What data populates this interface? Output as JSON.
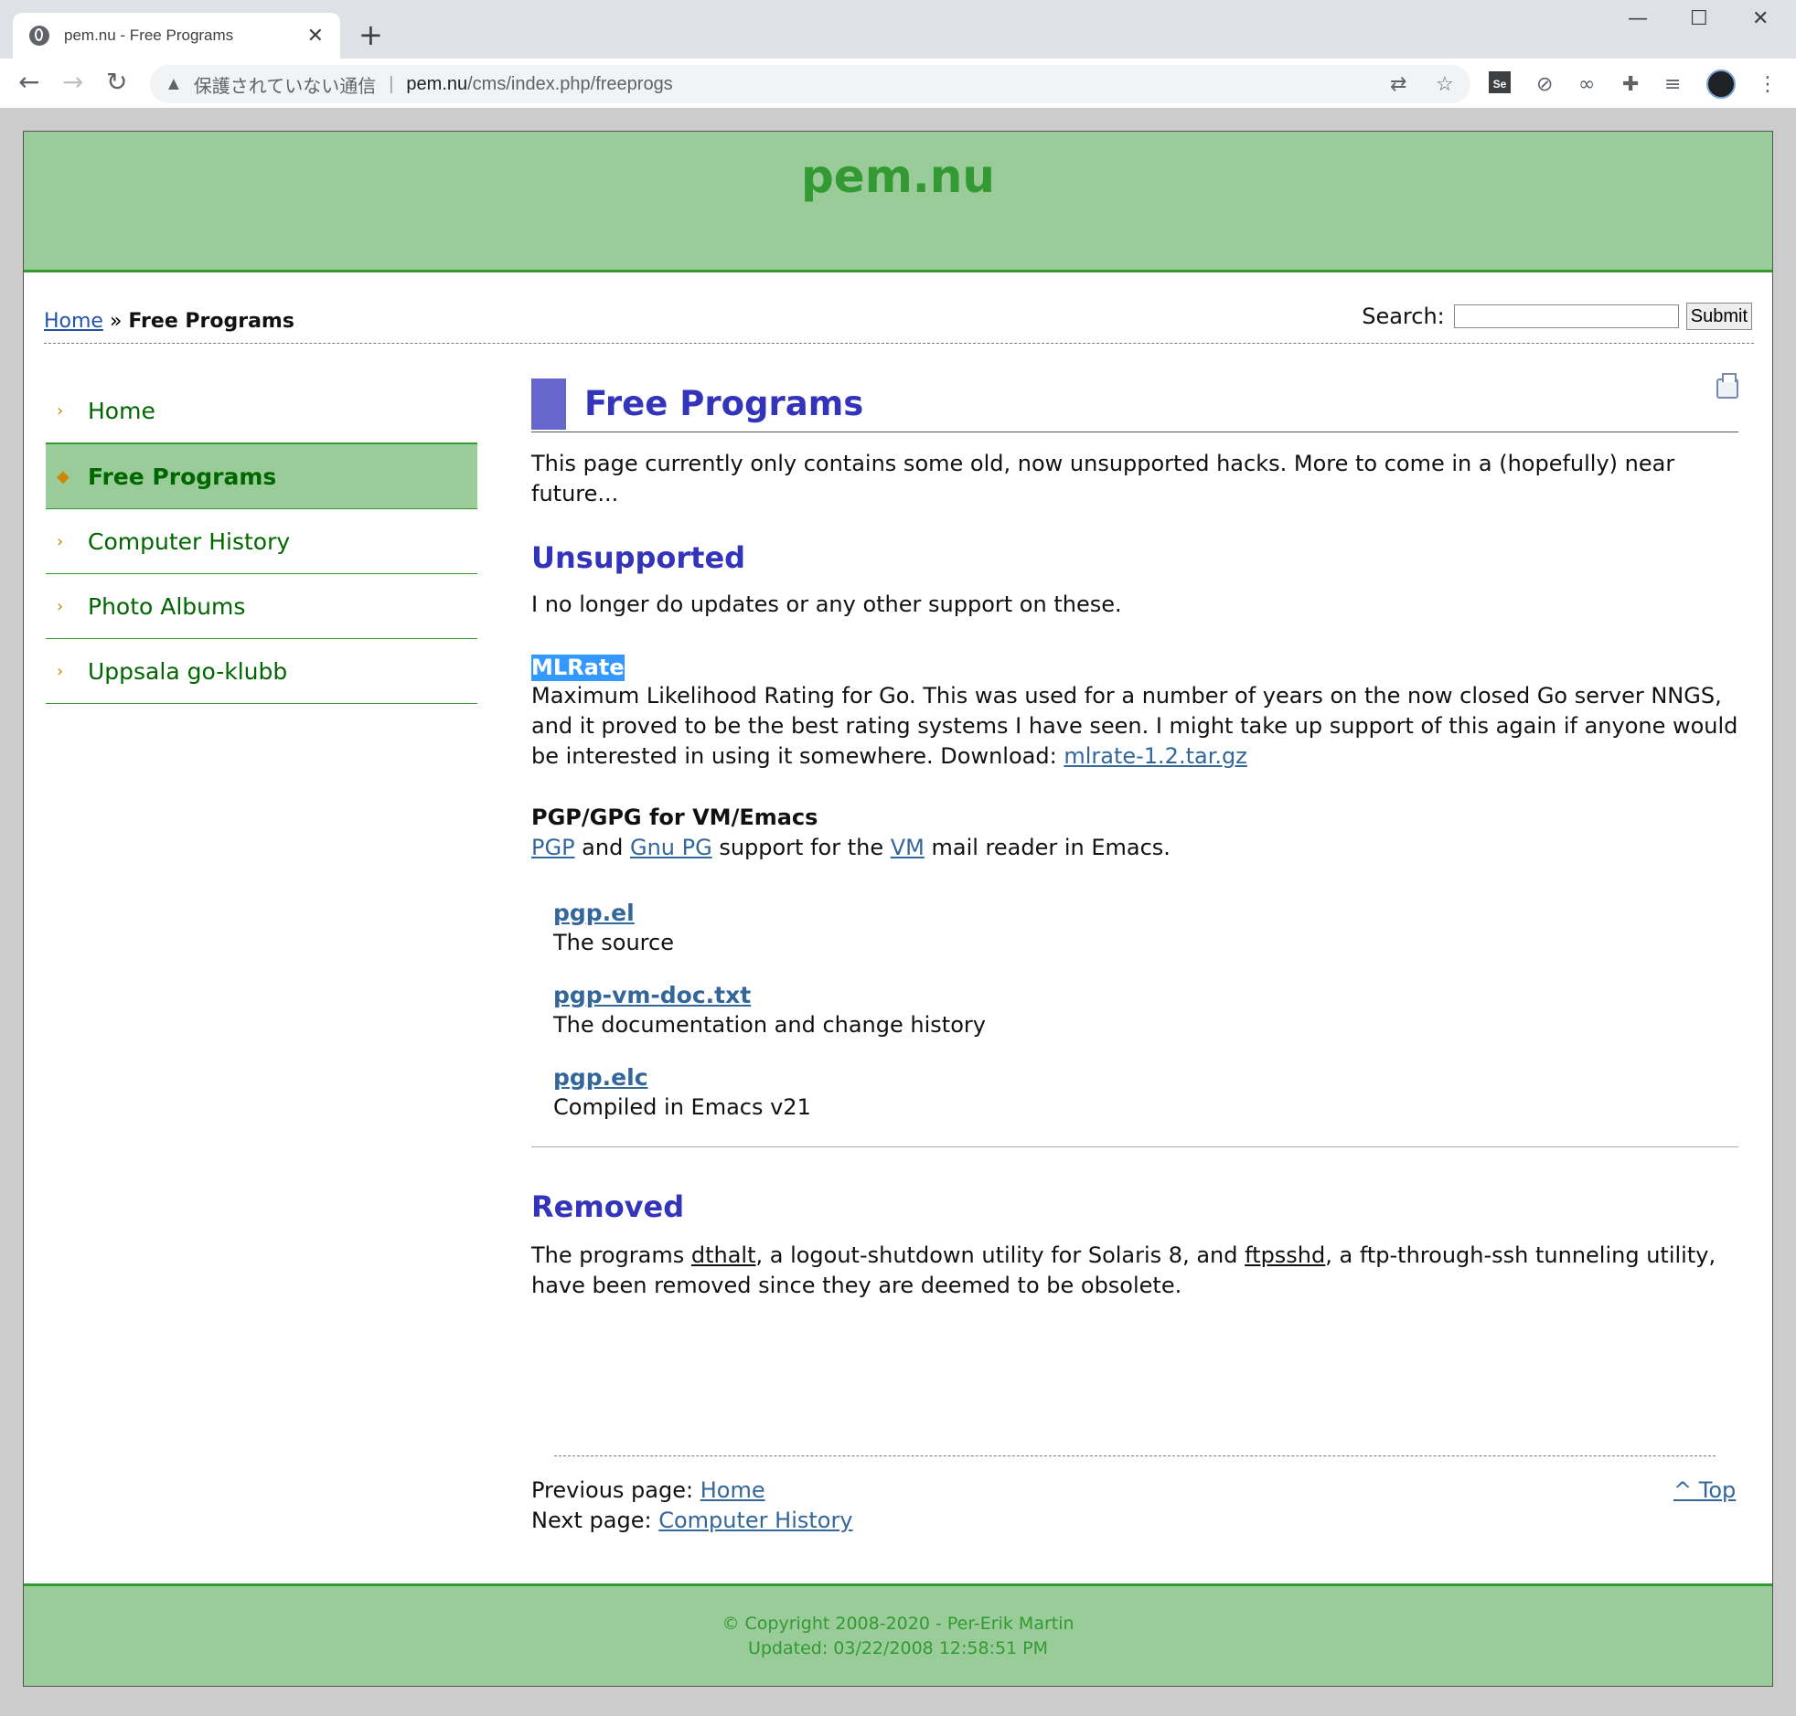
{
  "browser": {
    "tab_title": "pem.nu - Free Programs",
    "tab_close": "✕",
    "new_tab": "+",
    "security_label": "保護されていない通信",
    "url_host": "pem.nu",
    "url_path": "/cms/index.php/freeprogs"
  },
  "site": {
    "title": "pem.nu"
  },
  "breadcrumb": {
    "home": "Home",
    "sep": " » ",
    "current": "Free Programs"
  },
  "search": {
    "label": "Search:",
    "placeholder": "",
    "submit": "Submit"
  },
  "sidebar": {
    "items": [
      {
        "label": "Home",
        "active": false
      },
      {
        "label": "Free Programs",
        "active": true
      },
      {
        "label": "Computer History",
        "active": false
      },
      {
        "label": "Photo Albums",
        "active": false
      },
      {
        "label": "Uppsala go-klubb",
        "active": false
      }
    ]
  },
  "content": {
    "heading": "Free Programs",
    "intro": "This page currently only contains some old, now unsupported hacks. More to come in a (hopefully) near future...",
    "unsupported_heading": "Unsupported",
    "unsupported_note": "I no longer do updates or any other support on these.",
    "mlrate": {
      "title": "MLRate",
      "text": "Maximum Likelihood Rating for Go. This was used for a number of years on the now closed Go server NNGS, and it proved to be the best rating systems I have seen. I might take up support of this again if anyone would be interested in using it somewhere. Download: ",
      "link": "mlrate-1.2.tar.gz"
    },
    "pgp": {
      "title": "PGP/GPG for VM/Emacs",
      "link_pgp": "PGP",
      "and": " and ",
      "link_gnupg": "Gnu PG",
      "support_for": " support for the ",
      "link_vm": "VM",
      "tail": " mail reader in Emacs.",
      "files": [
        {
          "name": "pgp.el",
          "desc": "The source"
        },
        {
          "name": "pgp-vm-doc.txt",
          "desc": "The documentation and change history"
        },
        {
          "name": "pgp.elc",
          "desc": "Compiled in Emacs v21"
        }
      ]
    },
    "removed_heading": "Removed",
    "removed": {
      "t1": "The programs ",
      "l1": "dthalt",
      "t2": ", a logout-shutdown utility for Solaris 8, and ",
      "l2": "ftpsshd",
      "t3": ", a ftp-through-ssh tunneling utility, have been removed since they are deemed to be obsolete."
    }
  },
  "pagenav": {
    "prev_label": "Previous page: ",
    "prev_link": "Home",
    "next_label": "Next page: ",
    "next_link": "Computer History",
    "top": "^ Top"
  },
  "footer": {
    "copyright": "© Copyright 2008-2020 - Per-Erik Martin",
    "updated": "Updated: 03/22/2008 12:58:51 PM"
  }
}
